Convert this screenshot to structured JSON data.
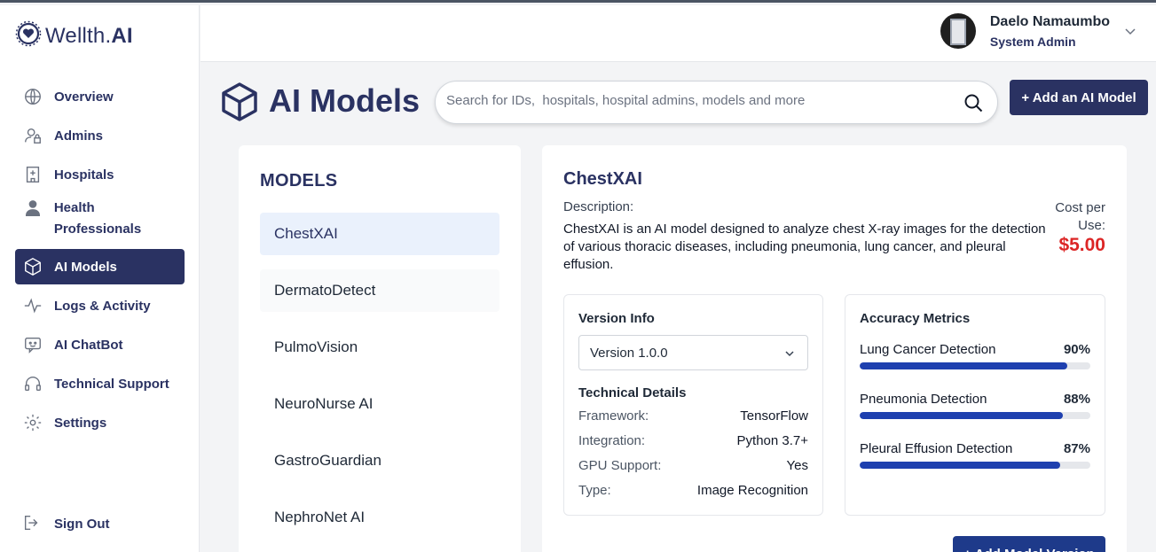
{
  "brand": {
    "name_a": "Wellth.",
    "name_b": "AI"
  },
  "sidebar": {
    "items": [
      {
        "label": "Overview",
        "icon": "globe-icon"
      },
      {
        "label": "Admins",
        "icon": "user-lock-icon"
      },
      {
        "label": "Hospitals",
        "icon": "hospital-icon"
      },
      {
        "label": "Health Professionals",
        "icon": "doctor-icon"
      },
      {
        "label": "AI Models",
        "icon": "cube-icon",
        "active": true
      },
      {
        "label": "Logs & Activity",
        "icon": "activity-icon"
      },
      {
        "label": "AI ChatBot",
        "icon": "chatbot-icon"
      },
      {
        "label": "Technical Support",
        "icon": "headset-icon"
      },
      {
        "label": "Settings",
        "icon": "gear-icon"
      }
    ],
    "signout": "Sign Out"
  },
  "user": {
    "name": "Daelo Namaumbo",
    "role": "System Admin"
  },
  "page": {
    "title": "AI Models",
    "search_placeholder": "Search for IDs,  hospitals, hospital admins, models and more",
    "add_button": "+ Add an AI Model"
  },
  "models": {
    "title": "MODELS",
    "items": [
      "ChestXAI",
      "DermatoDetect",
      "PulmoVision",
      "NeuroNurse AI",
      "GastroGuardian",
      "NephroNet AI"
    ],
    "selected": "ChestXAI"
  },
  "detail": {
    "name": "ChestXAI",
    "description_label": "Description:",
    "description": "ChestXAI is an AI model designed to analyze chest X-ray images for the detection of various thoracic diseases, including pneumonia, lung cancer, and pleural effusion.",
    "cost_label": "Cost per Use:",
    "cost": "$5.00",
    "version_info_title": "Version Info",
    "version": "Version 1.0.0",
    "technical_title": "Technical Details",
    "technical": [
      {
        "key": "Framework:",
        "value": "TensorFlow"
      },
      {
        "key": "Integration:",
        "value": "Python 3.7+"
      },
      {
        "key": "GPU Support:",
        "value": "Yes"
      },
      {
        "key": "Type:",
        "value": "Image Recognition"
      }
    ],
    "accuracy_title": "Accuracy Metrics",
    "metrics": [
      {
        "label": "Lung Cancer Detection",
        "percent": "90%",
        "value": 90
      },
      {
        "label": "Pneumonia Detection",
        "percent": "88%",
        "value": 88
      },
      {
        "label": "Pleural Effusion Detection",
        "percent": "87%",
        "value": 87
      }
    ],
    "add_version": "+ Add Model Version"
  },
  "colors": {
    "brand": "#2a3262",
    "cost": "#dc2626",
    "bar": "#1e40af",
    "selected_bg": "#eaf1fc"
  }
}
